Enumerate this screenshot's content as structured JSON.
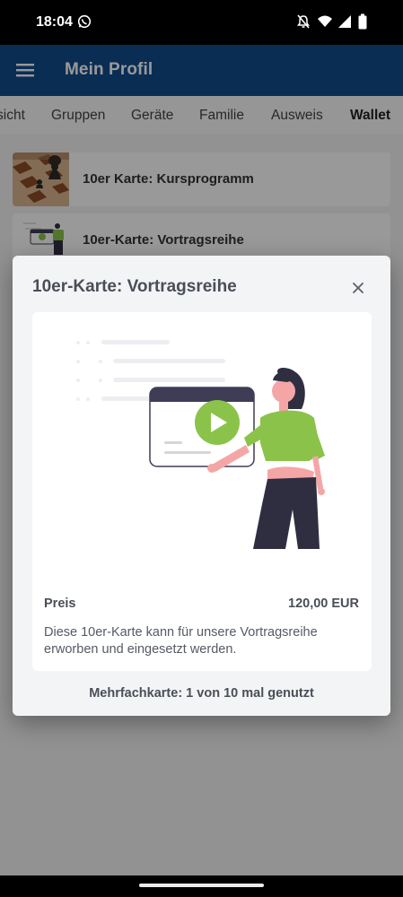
{
  "status_bar": {
    "time": "18:04",
    "icons": [
      "whatsapp-icon",
      "mute-icon",
      "wifi-icon",
      "signal-icon",
      "battery-icon"
    ]
  },
  "app_bar": {
    "title": "Mein Profil",
    "menu_icon": "menu-icon",
    "background_color": "#114b8d"
  },
  "tabs": [
    {
      "label": "sicht",
      "active": false
    },
    {
      "label": "Gruppen",
      "active": false
    },
    {
      "label": "Geräte",
      "active": false
    },
    {
      "label": "Familie",
      "active": false
    },
    {
      "label": "Ausweis",
      "active": false
    },
    {
      "label": "Wallet",
      "active": true
    }
  ],
  "wallet_items": [
    {
      "title": "10er Karte: Kursprogramm",
      "thumbnail": "chess-image"
    },
    {
      "title": "10er-Karte: Vortragsreihe",
      "thumbnail": "presentation-image"
    }
  ],
  "dialog": {
    "title": "10er-Karte: Vortragsreihe",
    "close_icon": "close-icon",
    "price_label": "Preis",
    "price_value": "120,00 EUR",
    "description": "Diese 10er-Karte kann für unsere Vortragsreihe erworben und eingesetzt werden.",
    "usage": "Mehrfachkarte: 1 von 10 mal genutzt",
    "accent_color": "#8bc34a"
  }
}
